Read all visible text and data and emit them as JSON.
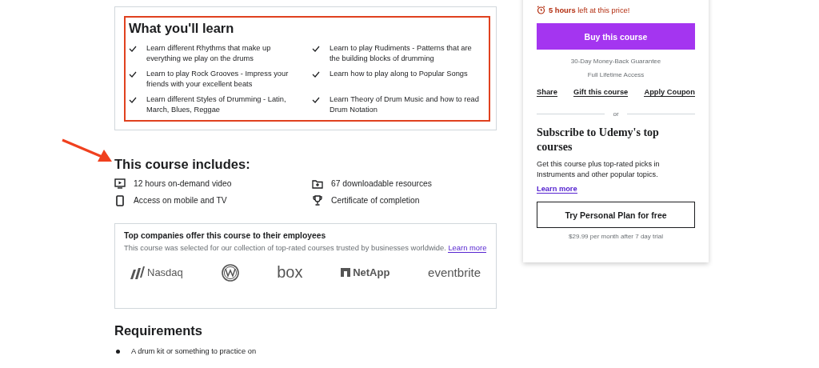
{
  "learn": {
    "title": "What you'll learn",
    "items": [
      "Learn different Rhythms that make up everything we play on the drums",
      "Learn to play Rudiments - Patterns that are the building blocks of drumming",
      "Learn to play Rock Grooves - Impress your friends with your excellent beats",
      "Learn how to play along to Popular Songs",
      "Learn different Styles of Drumming - Latin, March, Blues, Reggae",
      "Learn Theory of Drum Music and how to read Drum Notation"
    ]
  },
  "includes": {
    "title": "This course includes:",
    "items": [
      {
        "kind": "video",
        "text": "12 hours on-demand video"
      },
      {
        "kind": "download",
        "text": "67 downloadable resources"
      },
      {
        "kind": "mobile",
        "text": "Access on mobile and TV"
      },
      {
        "kind": "certificate",
        "text": "Certificate of completion"
      }
    ]
  },
  "companies": {
    "title": "Top companies offer this course to their employees",
    "text": "This course was selected for our collection of top-rated courses trusted by businesses worldwide.",
    "link": "Learn more",
    "logos": [
      {
        "kind": "mark-text",
        "text": "Nasdaq"
      },
      {
        "kind": "emblem"
      },
      {
        "kind": "word",
        "text": "box"
      },
      {
        "kind": "square-text",
        "text": "NetApp"
      },
      {
        "kind": "word",
        "text": "eventbrite"
      }
    ]
  },
  "requirements": {
    "title": "Requirements",
    "items": [
      "A drum kit or something to practice on"
    ]
  },
  "sidebar": {
    "timer": "**5 hours** left at this price!",
    "buy_button": "Buy this course",
    "guarantee": "30-Day Money-Back Guarantee",
    "access": "Full Lifetime Access",
    "actions": [
      "Share",
      "Gift this course",
      "Apply Coupon"
    ],
    "divider": "or",
    "subscribe_title": "Subscribe to Udemy's top courses",
    "subscribe_text": "Get this course plus top-rated picks in Instruments and other popular topics.",
    "subscribe_link": "Learn more",
    "plan_button": "Try Personal Plan for free",
    "plan_note": "$29.99 per month after 7 day trial"
  }
}
